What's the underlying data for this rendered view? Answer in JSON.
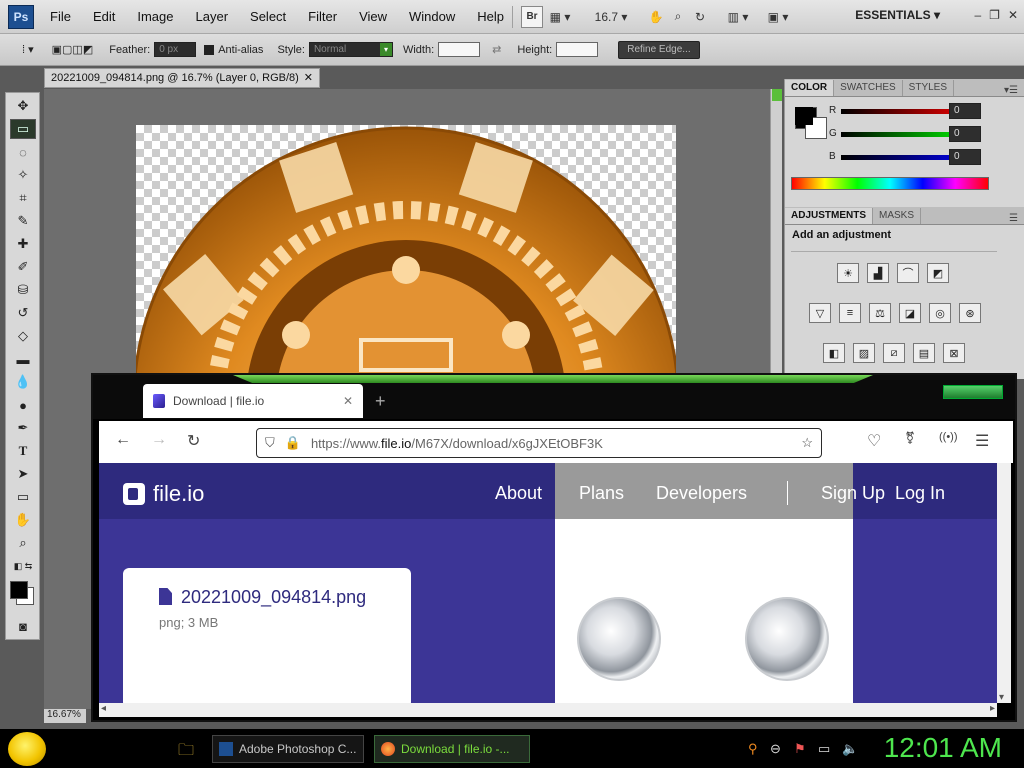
{
  "photoshop": {
    "logo": "Ps",
    "menu": [
      "File",
      "Edit",
      "Image",
      "Layer",
      "Select",
      "Filter",
      "View",
      "Window",
      "Help"
    ],
    "zoom_dropdown": "16.7",
    "workspace": "ESSENTIALS",
    "options": {
      "feather_label": "Feather:",
      "feather_value": "0 px",
      "antialias_label": "Anti-alias",
      "style_label": "Style:",
      "style_value": "Normal",
      "width_label": "Width:",
      "height_label": "Height:",
      "refine_edge": "Refine Edge..."
    },
    "document_tab": "20221009_094814.png @ 16.7% (Layer 0, RGB/8)",
    "status_zoom": "16.67%",
    "color_panel": {
      "tabs": [
        "COLOR",
        "SWATCHES",
        "STYLES"
      ],
      "r_label": "R",
      "g_label": "G",
      "b_label": "B",
      "r_value": "0",
      "g_value": "0",
      "b_value": "0"
    },
    "adjustments_panel": {
      "tabs": [
        "ADJUSTMENTS",
        "MASKS"
      ],
      "heading": "Add an adjustment"
    }
  },
  "browser": {
    "tab_title": "Download | file.io",
    "url_prefix": "https://www.",
    "url_domain": "file.io",
    "url_path": "/M67X/download/x6gJXEtOBF3K"
  },
  "fileio": {
    "logo_text": "file.io",
    "nav": [
      "About",
      "Plans",
      "Developers",
      "Sign Up",
      "Log In"
    ],
    "file_name": "20221009_094814.png",
    "file_meta": "png; 3 MB"
  },
  "taskbar": {
    "items": [
      "Adobe Photoshop C...",
      "Download | file.io -..."
    ],
    "clock": "12:01 AM"
  },
  "colors": {
    "fileio_bg": "#3c3596",
    "fileio_header": "#2e2a7e",
    "clock": "#4ee64e",
    "chip_orange": "#e89a32"
  }
}
